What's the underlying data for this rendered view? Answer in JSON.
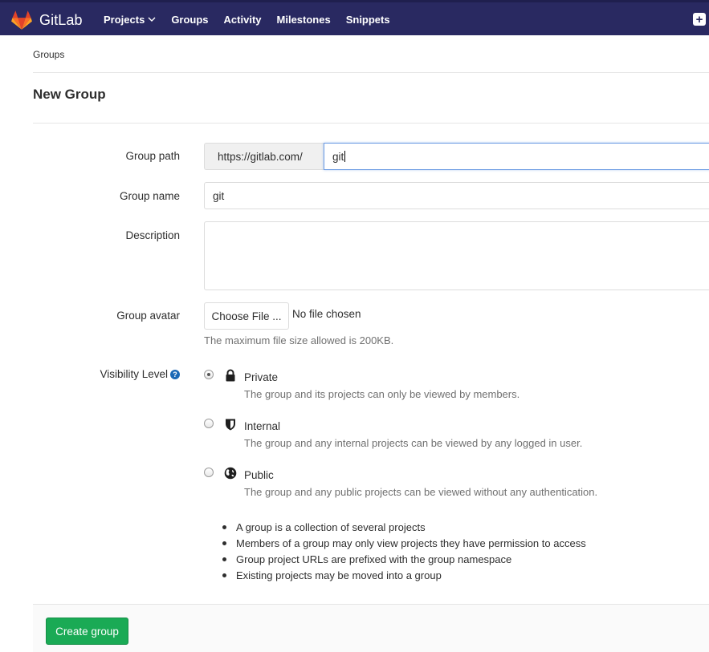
{
  "navbar": {
    "brand": "GitLab",
    "links": [
      "Projects",
      "Groups",
      "Activity",
      "Milestones",
      "Snippets"
    ],
    "plus_icon": "+"
  },
  "breadcrumb": "Groups",
  "page_title": "New Group",
  "form": {
    "group_path": {
      "label": "Group path",
      "prefix": "https://gitlab.com/",
      "value": "git"
    },
    "group_name": {
      "label": "Group name",
      "value": "git"
    },
    "description": {
      "label": "Description",
      "value": ""
    },
    "avatar": {
      "label": "Group avatar",
      "button": "Choose File ...",
      "status": "No file chosen",
      "help": "The maximum file size allowed is 200KB."
    },
    "visibility": {
      "label": "Visibility Level",
      "help_icon": "?",
      "options": [
        {
          "title": "Private",
          "desc": "The group and its projects can only be viewed by members.",
          "icon": "lock-icon",
          "checked": true
        },
        {
          "title": "Internal",
          "desc": "The group and any internal projects can be viewed by any logged in user.",
          "icon": "shield-icon",
          "checked": false
        },
        {
          "title": "Public",
          "desc": "The group and any public projects can be viewed without any authentication.",
          "icon": "globe-icon",
          "checked": false
        }
      ]
    },
    "notes": [
      "A group is a collection of several projects",
      "Members of a group may only view projects they have permission to access",
      "Group project URLs are prefixed with the group namespace",
      "Existing projects may be moved into a group"
    ],
    "submit": "Create group"
  },
  "colors": {
    "navbar": "#292961",
    "submit": "#1aaa55",
    "help_icon": "#1b69b6"
  }
}
